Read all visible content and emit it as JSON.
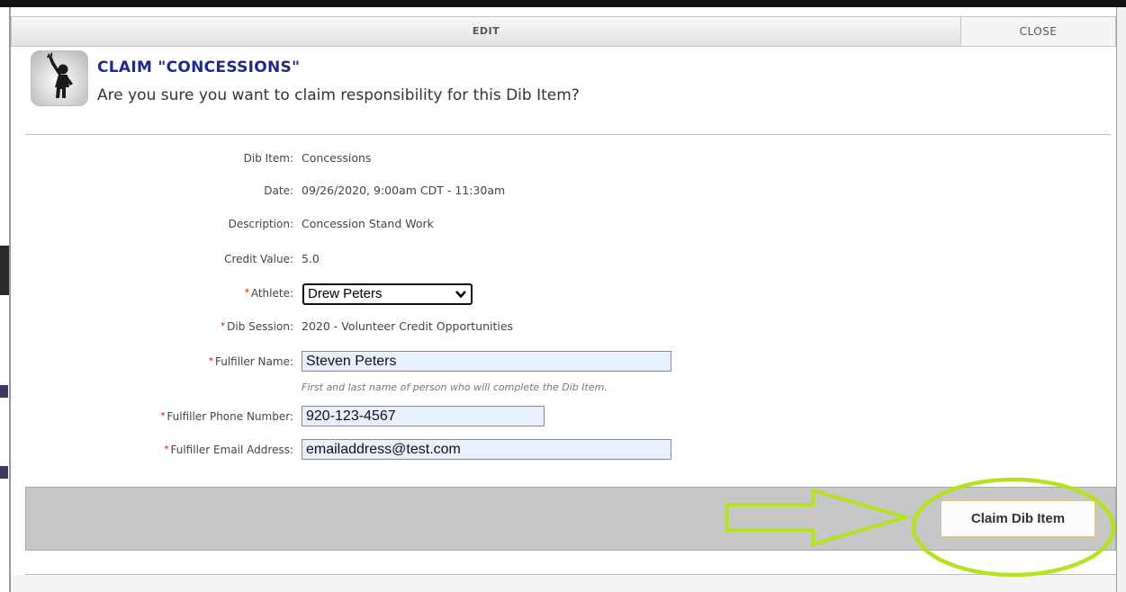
{
  "dialog": {
    "title_tab": "EDIT",
    "close_label": "CLOSE",
    "heading": "CLAIM \"CONCESSIONS\"",
    "question": "Are you sure you want to claim responsibility for this Dib Item?"
  },
  "details": {
    "dib_item": {
      "label": "Dib Item:",
      "value": "Concessions"
    },
    "date": {
      "label": "Date:",
      "value": "09/26/2020, 9:00am CDT - 11:30am"
    },
    "description": {
      "label": "Description:",
      "value": "Concession Stand Work"
    },
    "credit_value": {
      "label": "Credit Value:",
      "value": "5.0"
    },
    "athlete": {
      "label": "Athlete:",
      "selected": "Drew Peters"
    },
    "dib_session": {
      "label": "Dib Session:",
      "value": "2020 - Volunteer Credit Opportunities"
    },
    "fulfiller_name": {
      "label": "Fulfiller Name:",
      "value": "Steven Peters",
      "hint": "First and last name of person who will complete the Dib Item."
    },
    "fulfiller_phone": {
      "label": "Fulfiller Phone Number:",
      "value": "920-123-4567"
    },
    "fulfiller_email": {
      "label": "Fulfiller Email Address:",
      "value": "emailaddress@test.com"
    }
  },
  "required_marker": "*",
  "actions": {
    "claim_label": "Claim Dib Item"
  },
  "colors": {
    "heading": "#1e2a8a",
    "required": "#dd0000",
    "annotation": "#b5e21e",
    "input_fill": "#e8f0fe",
    "footer": "#c7c7c7"
  },
  "icons": {
    "dialog_icon": "raised-hand-figure-icon",
    "select_chevron": "chevron-down-icon"
  }
}
